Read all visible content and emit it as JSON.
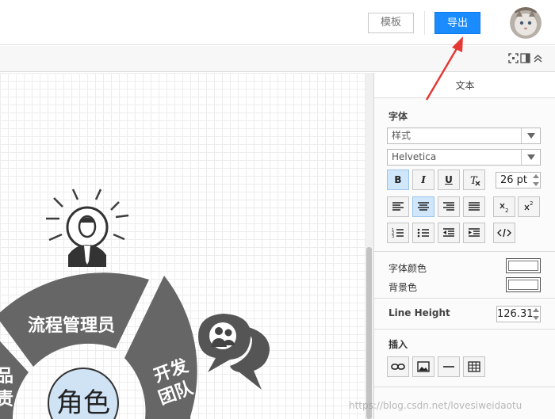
{
  "topbar": {
    "template_label": "模板",
    "export_label": "导出"
  },
  "panel": {
    "title": "文本",
    "font_section_label": "字体",
    "style_select_value": "样式",
    "font_select_value": "Helvetica",
    "bold_label": "B",
    "italic_label": "I",
    "underline_label": "U",
    "font_size_value": "26 pt",
    "font_color_label": "字体颜色",
    "background_color_label": "背景色",
    "line_height_label": "Line Height",
    "line_height_value": "126.31",
    "insert_label": "插入"
  },
  "diagram": {
    "center_label": "角色",
    "segment_top": "流程管理员",
    "segment_right_line1": "开发",
    "segment_right_line2": "团队",
    "segment_left_line1": "品",
    "segment_left_line2": "责"
  },
  "watermark": "https://blog.csdn.net/lovesiweidaotu",
  "colors": {
    "export_button": "#1a8cff",
    "arrow": "#e53935",
    "segment_fill": "#666666",
    "center_fill": "#cfe3f5"
  }
}
